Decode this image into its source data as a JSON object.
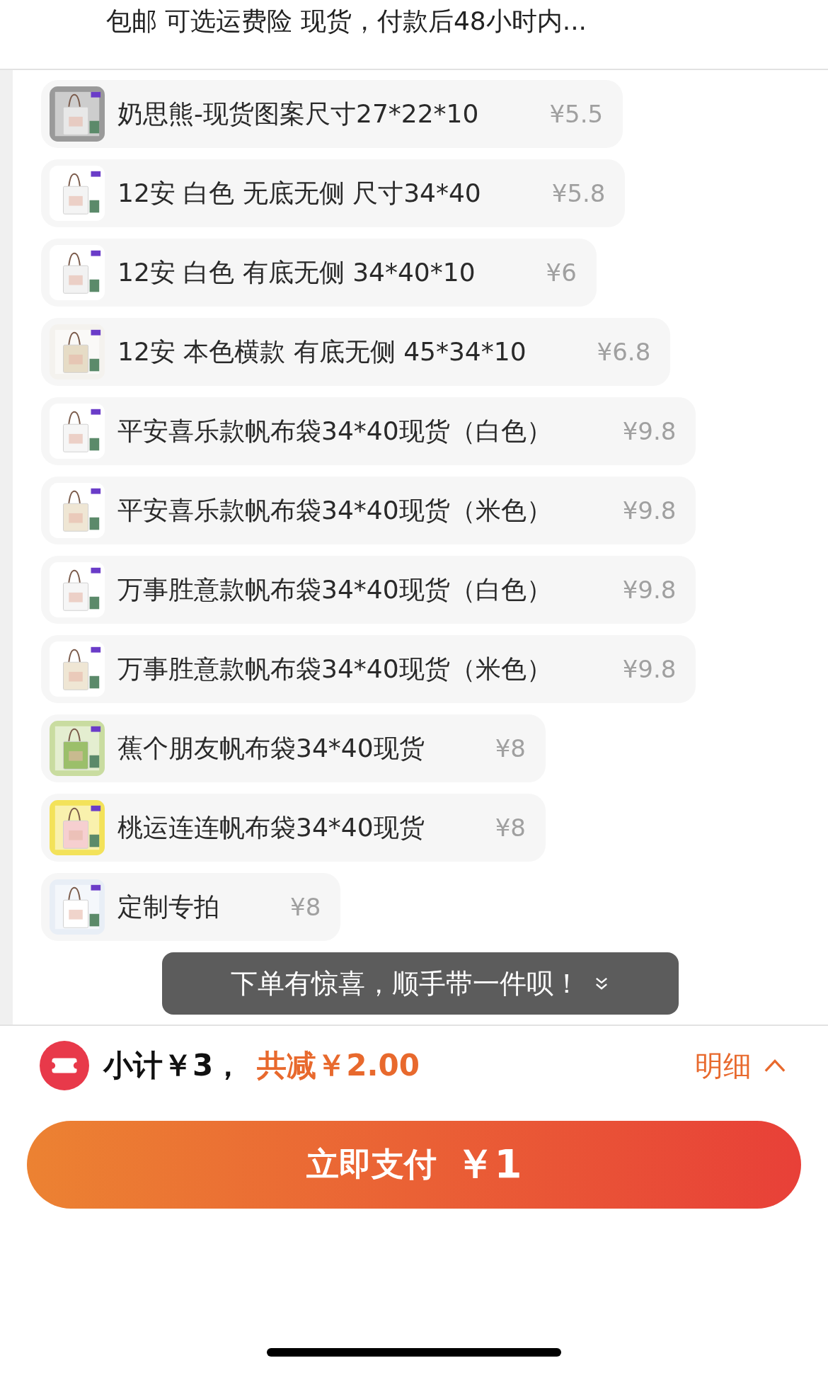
{
  "header": {
    "text": "包邮  可选运费险  现货，付款后48小时内..."
  },
  "items": [
    {
      "title": "奶思熊-现货图案尺寸27*22*10",
      "price": "¥5.5"
    },
    {
      "title": "12安 白色 无底无侧 尺寸34*40",
      "price": "¥5.8"
    },
    {
      "title": "12安 白色 有底无侧 34*40*10",
      "price": "¥6"
    },
    {
      "title": "12安 本色横款 有底无侧 45*34*10",
      "price": "¥6.8"
    },
    {
      "title": "平安喜乐款帆布袋34*40现货（白色）",
      "price": "¥9.8"
    },
    {
      "title": "平安喜乐款帆布袋34*40现货（米色）",
      "price": "¥9.8"
    },
    {
      "title": "万事胜意款帆布袋34*40现货（白色）",
      "price": "¥9.8"
    },
    {
      "title": "万事胜意款帆布袋34*40现货（米色）",
      "price": "¥9.8"
    },
    {
      "title": "蕉个朋友帆布袋34*40现货",
      "price": "¥8"
    },
    {
      "title": "桃运连连帆布袋34*40现货",
      "price": "¥8"
    },
    {
      "title": "定制专拍",
      "price": "¥8"
    }
  ],
  "toast": {
    "text": "下单有惊喜，顺手带一件呗！"
  },
  "summary": {
    "subtotal": "小计￥3，",
    "discount": "共减￥2.00",
    "details": "明细"
  },
  "pay_button": {
    "label": "立即支付",
    "amount": "￥1"
  }
}
